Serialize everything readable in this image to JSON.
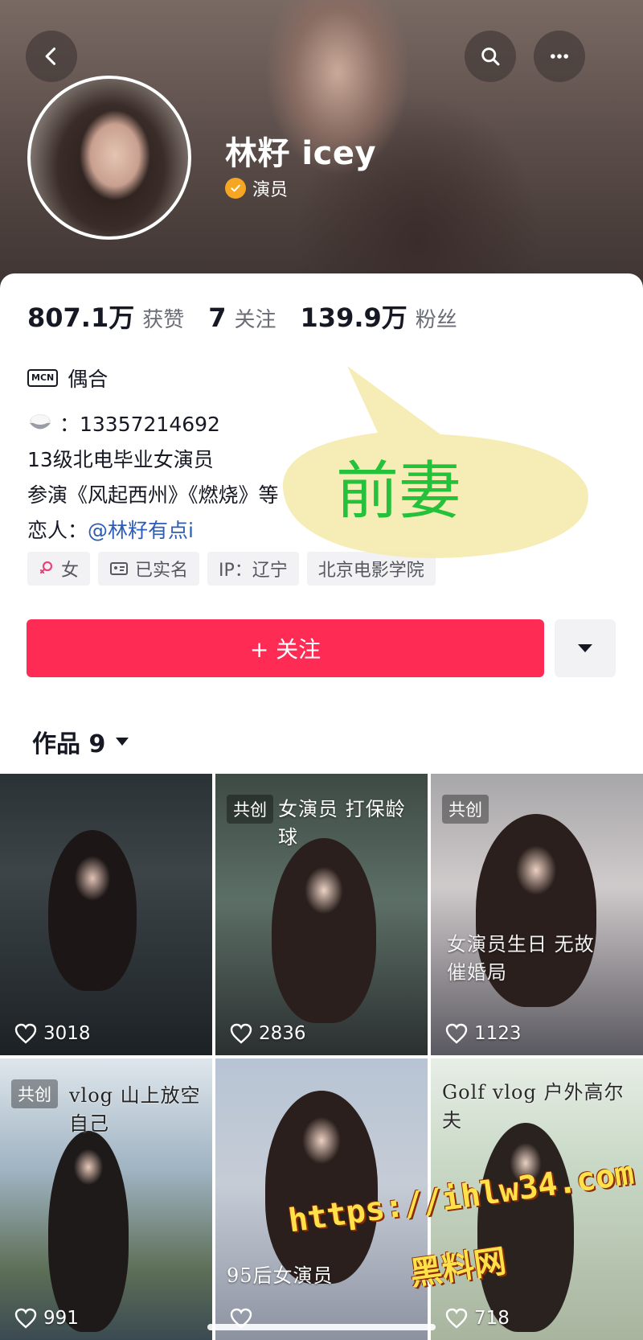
{
  "profile": {
    "name": "林籽 icey",
    "role": "演员"
  },
  "stats": [
    {
      "value": "807.1万",
      "label": "获赞"
    },
    {
      "value": "7",
      "label": "关注"
    },
    {
      "value": "139.9万",
      "label": "粉丝"
    }
  ],
  "mcn": {
    "icon_text": "MCN",
    "name": "偶合"
  },
  "bio": {
    "phone": "：13357214692",
    "line1": "13级北电毕业女演员",
    "line2": "参演《风起西州》《燃烧》等",
    "partner_label": "恋人：",
    "partner_link": "@林籽有点i"
  },
  "tags": [
    "女",
    "已实名",
    "IP：辽宁",
    "北京电影学院"
  ],
  "actions": {
    "follow_label": "+ 关注"
  },
  "works_tab": {
    "label": "作品 9"
  },
  "videos": [
    {
      "likes": "3018",
      "tag": "",
      "caption": ""
    },
    {
      "likes": "2836",
      "tag": "共创",
      "caption": "女演员 打保龄球"
    },
    {
      "likes": "1123",
      "tag": "共创",
      "caption": "女演员生日 无故催婚局"
    },
    {
      "likes": "991",
      "tag": "共创",
      "caption": "vlog 山上放空自己"
    },
    {
      "likes": "",
      "tag": "",
      "caption": "95后女演员"
    },
    {
      "likes": "718",
      "tag": "",
      "caption": "Golf vlog 户外高尔夫"
    }
  ],
  "overlays": {
    "bubble_text": "前妻",
    "watermark_url": "https://ihlw34.com",
    "watermark_name": "黑料网"
  },
  "colors": {
    "accent": "#fe2c55",
    "link": "#2b5db8",
    "bubble": "#f5eab0",
    "bubble_text": "#26c13a"
  }
}
